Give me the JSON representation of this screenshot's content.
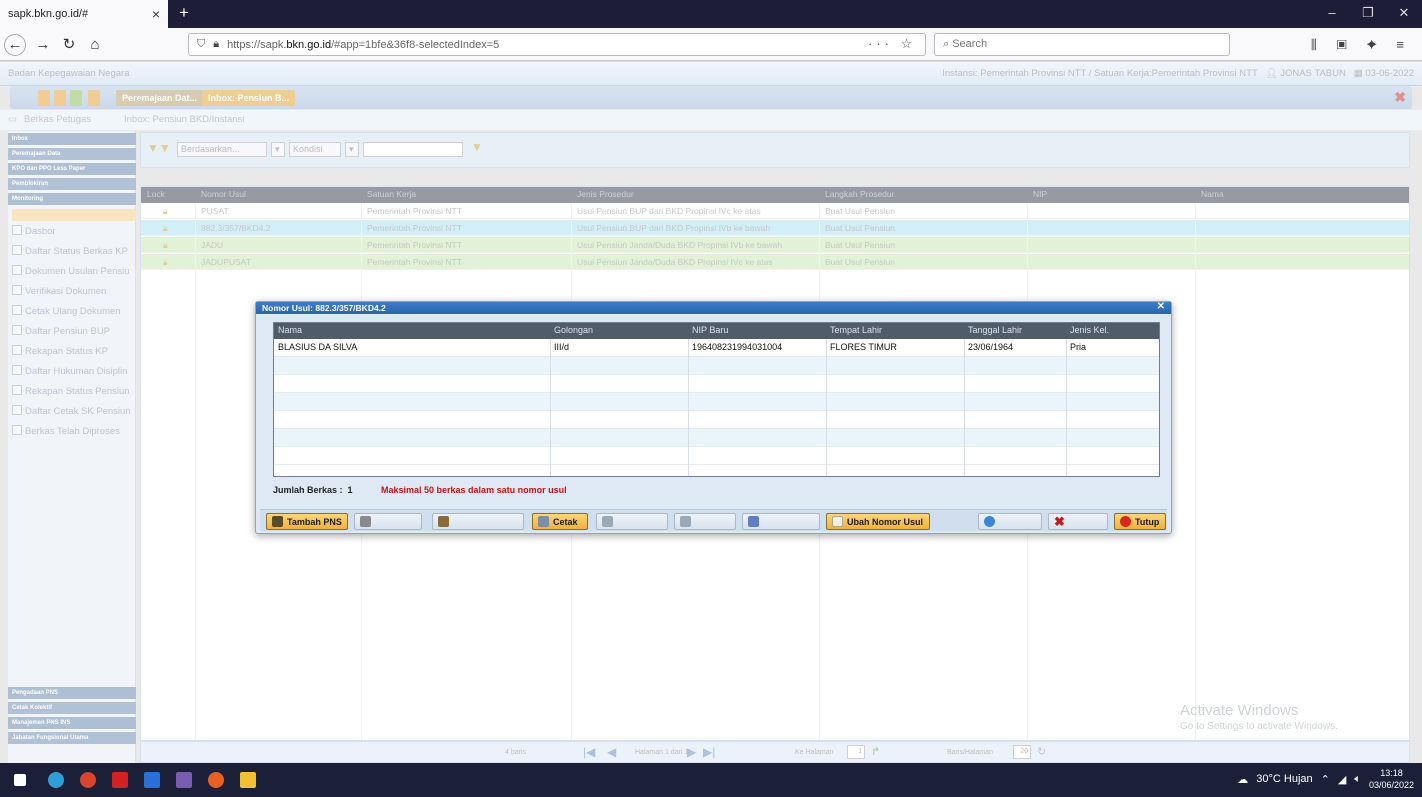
{
  "browser": {
    "tab_title": "sapk.bkn.go.id/#",
    "tab_close": "×",
    "new_tab": "+",
    "url_domain_prefix": "https://sapk.",
    "url_domain": "bkn.go.id",
    "url_path": "/#app=1bfe&36f8-selectedIndex=5",
    "url_icons": "··· ☆",
    "search_placeholder": "Search"
  },
  "app": {
    "org_name": "Badan Kepegawaian Negara",
    "instansi_info": "Instansi: Pemerintah Provinsi NTT / Satuan Kerja:Pemerintah Provinsi NTT",
    "user_name": "JONAS TABUN",
    "date": "03-06-2022",
    "toolbar_tabs": [
      "Peremajaan Dat...",
      "Inbox: Pensiun B..."
    ],
    "breadcrumb_left": "Berkas Petugas",
    "breadcrumb_right": "Inbox: Pensiun BKD/Instansi"
  },
  "sidebar": {
    "top_sections": [
      "Inbox",
      "Peremajaan Data",
      "KPO dan PPO Less Paper",
      "Pemblokiran",
      "Monitoring"
    ],
    "items": [
      "Dasbor",
      "Daftar Status Berkas KP",
      "Dokumen Usulan Pensiu",
      "Verifikasi Dokumen",
      "Cetak Ulang Dokumen",
      "Daftar Pensiun BUP",
      "Rekapan Status KP",
      "Daftar Hukuman Disiplin",
      "Rekapan Status Pensiun",
      "Daftar Cetak SK Pensiun",
      "Berkas Telah Diproses"
    ],
    "bottom_sections": [
      "Pengadaan PNS",
      "Cetak Kolektif",
      "Manajemen PNS INS",
      "Jabatan Fungsional Utama"
    ]
  },
  "filter": {
    "berdasarkan": "Berdasarkan...",
    "kondisi": "Kondisi"
  },
  "grid": {
    "columns": [
      "Lock",
      "Nomor Usul",
      "Satuan Kerja",
      "Jenis Prosedur",
      "Langkah Prosedur",
      "NIP",
      "Nama"
    ],
    "rows": [
      {
        "nomor": "PUSAT",
        "satker": "Pemerintah Provinsi NTT",
        "jenis": "Usul Pensiun BUP dari BKD Propinsi IVc ke atas",
        "langkah": "Buat Usul Pensiun"
      },
      {
        "nomor": "882.3/357/BKD4.2",
        "satker": "Pemerintah Provinsi NTT",
        "jenis": "Usul Pensiun BUP dari BKD Propinsi IVb ke bawah",
        "langkah": "Buat Usul Pensiun"
      },
      {
        "nomor": "JADU",
        "satker": "Pemerintah Provinsi NTT",
        "jenis": "Usul Pensiun Janda/Duda BKD Propinsi IVb ke bawah",
        "langkah": "Buat Usul Pensiun"
      },
      {
        "nomor": "JADUPUSAT",
        "satker": "Pemerintah Provinsi NTT",
        "jenis": "Usul Pensiun Janda/Duda BKD Propinsi IVc ke atas",
        "langkah": "Buat Usul Pensiun"
      }
    ],
    "footer_count": "4 baris",
    "footer_page": "Halaman 1 dari 1",
    "footer_goto": "Ke Halaman",
    "footer_goto_val": "1",
    "footer_rows_label": "Baris/Halaman",
    "footer_rows_val": "20"
  },
  "dialog": {
    "title": "Nomor Usul: 882.3/357/BKD4.2",
    "close": "✕",
    "columns": [
      "Nama",
      "Golongan",
      "NIP Baru",
      "Tempat Lahir",
      "Tanggal Lahir",
      "Jenis Kel."
    ],
    "rows": [
      {
        "nama": "BLASIUS DA SILVA",
        "golongan": "III/d",
        "nip": "196408231994031004",
        "tempat": "FLORES TIMUR",
        "tanggal": "23/06/1964",
        "jk": "Pria"
      }
    ],
    "count_label": "Jumlah Berkas :",
    "count_value": "1",
    "warning": "Maksimal 50 berkas dalam satu nomor usul",
    "buttons": {
      "tambah": "Tambah PNS",
      "cetak": "Cetak",
      "ubah": "Ubah Nomor Usul",
      "tutup": "Tutup"
    }
  },
  "watermark": {
    "title": "Activate Windows",
    "sub": "Go to Settings to activate Windows."
  },
  "taskbar": {
    "weather": "30°C Hujan",
    "time": "13:18",
    "date": "03/06/2022"
  }
}
